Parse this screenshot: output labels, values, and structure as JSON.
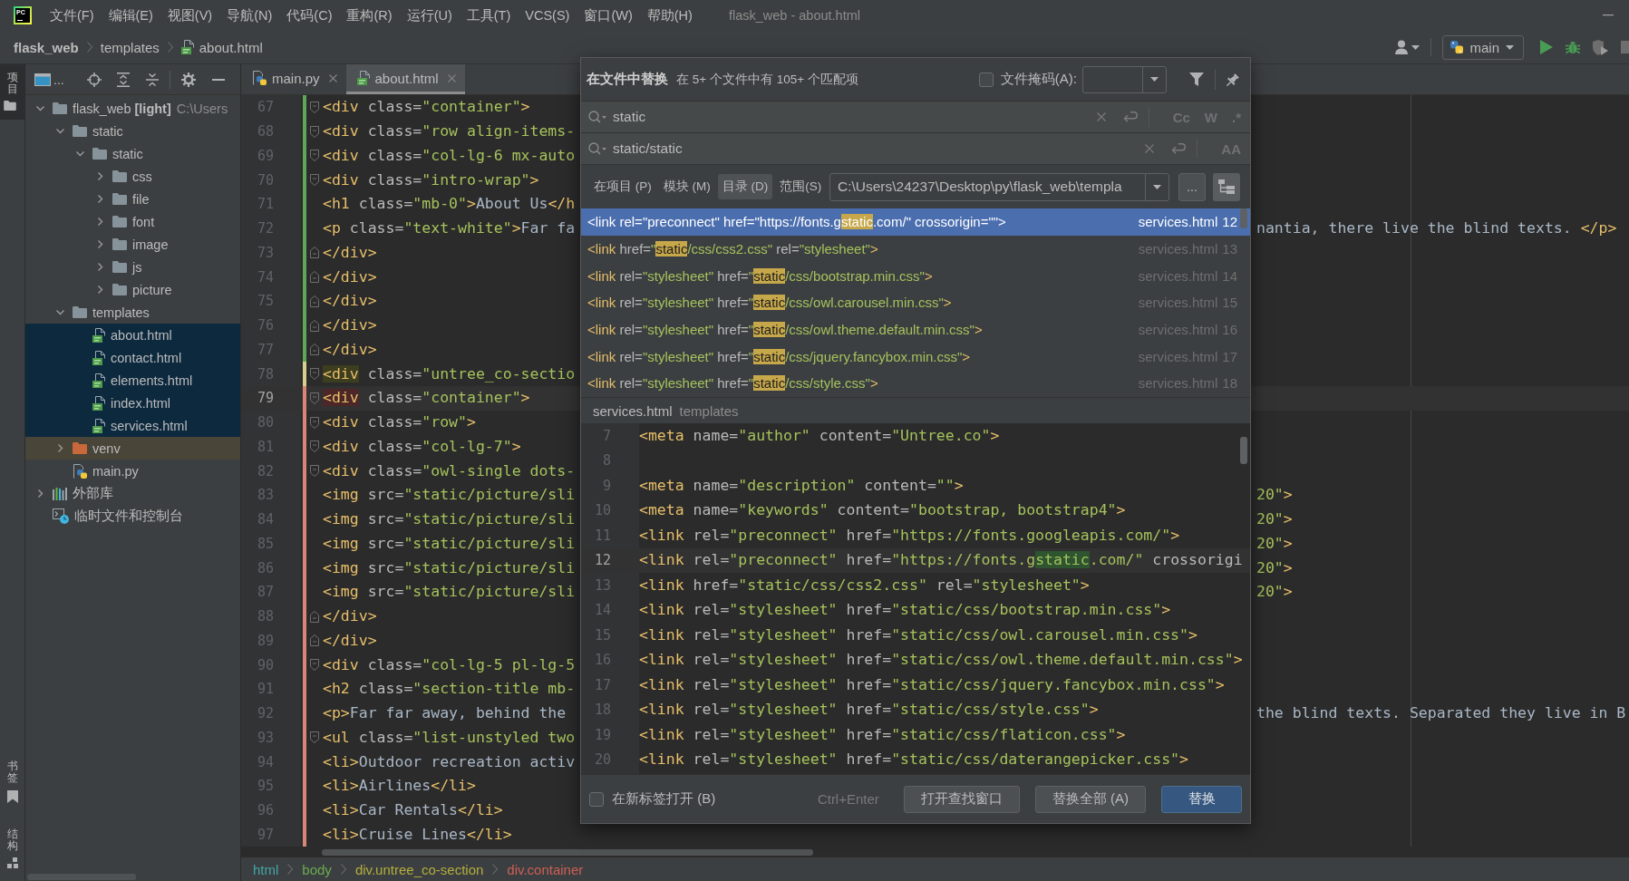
{
  "menu_bar": {
    "logo": "PC",
    "items": [
      "文件(F)",
      "编辑(E)",
      "视图(V)",
      "导航(N)",
      "代码(C)",
      "重构(R)",
      "运行(U)",
      "工具(T)",
      "VCS(S)",
      "窗口(W)",
      "帮助(H)"
    ],
    "title": "flask_web - about.html"
  },
  "navigation_bar": {
    "breadcrumbs": [
      {
        "label": "flask_web",
        "kind": "project"
      },
      {
        "label": "templates",
        "kind": "folder"
      },
      {
        "label": "about.html",
        "kind": "html"
      }
    ],
    "run_configuration": "main"
  },
  "tool_stripe": {
    "top": [
      {
        "label": "项目",
        "kind": "project",
        "selected": true
      }
    ],
    "bottom": [
      {
        "label": "书签",
        "kind": "bookmarks",
        "selected": false
      },
      {
        "label": "结构",
        "kind": "structure",
        "selected": false
      }
    ]
  },
  "project_panel": {
    "view_label": "...",
    "tree": [
      {
        "label": "flask_web **[light]**",
        "path": "C:\\Users",
        "kind": "folder",
        "expanded": true,
        "selected": false,
        "children": [
          {
            "label": "static",
            "kind": "folder",
            "expanded": true,
            "selected": false,
            "children": [
              {
                "label": "static",
                "kind": "folder",
                "expanded": true,
                "selected": false,
                "children": [
                  {
                    "label": "css",
                    "kind": "folder",
                    "expanded": false,
                    "selected": false
                  },
                  {
                    "label": "file",
                    "kind": "folder",
                    "expanded": false,
                    "selected": false
                  },
                  {
                    "label": "font",
                    "kind": "folder",
                    "expanded": false,
                    "selected": false
                  },
                  {
                    "label": "image",
                    "kind": "folder",
                    "expanded": false,
                    "selected": false
                  },
                  {
                    "label": "js",
                    "kind": "folder",
                    "expanded": false,
                    "selected": false
                  },
                  {
                    "label": "picture",
                    "kind": "folder",
                    "expanded": false,
                    "selected": false
                  }
                ]
              }
            ]
          },
          {
            "label": "templates",
            "kind": "folder",
            "expanded": true,
            "selected": false,
            "children": [
              {
                "label": "about.html",
                "kind": "html",
                "selected": true
              },
              {
                "label": "contact.html",
                "kind": "html",
                "selected": true
              },
              {
                "label": "elements.html",
                "kind": "html",
                "selected": true
              },
              {
                "label": "index.html",
                "kind": "html",
                "selected": true
              },
              {
                "label": "services.html",
                "kind": "html",
                "selected": true
              }
            ]
          },
          {
            "label": "venv",
            "kind": "excluded-folder",
            "expanded": false,
            "selected": false
          },
          {
            "label": "main.py",
            "kind": "python",
            "selected": false
          }
        ]
      },
      {
        "label": "外部库",
        "kind": "library",
        "expanded": false,
        "selected": false
      },
      {
        "label": "临时文件和控制台",
        "kind": "scratch",
        "selected": false
      }
    ]
  },
  "editor": {
    "tabs": [
      {
        "label": "main.py",
        "kind": "python",
        "selected": false
      },
      {
        "label": "about.html",
        "kind": "html",
        "selected": true
      }
    ],
    "lines": [
      {
        "number": "67",
        "text": "<div class=\"container\">",
        "color": "#5fa758",
        "kind": "fold-start",
        "current": false
      },
      {
        "number": "68",
        "text": "<div class=\"row align-items-",
        "color": "#5fa758",
        "kind": "fold-start",
        "current": false
      },
      {
        "number": "69",
        "text": "<div class=\"col-lg-6 mx-auto",
        "color": "#5fa758",
        "kind": "fold-start",
        "current": false
      },
      {
        "number": "70",
        "text": "<div class=\"intro-wrap\">",
        "color": "#5fa758",
        "kind": "fold-start",
        "current": false
      },
      {
        "number": "71",
        "text": "<h1 class=\"mb-0\">About Us</h",
        "color": "#5fa758",
        "kind": "plain",
        "current": false
      },
      {
        "number": "72",
        "text": "<p class=\"text-white\">Far fa",
        "tail": "nantia, there live the blind texts. </p>",
        "color": "#5fa758",
        "kind": "plain",
        "current": false
      },
      {
        "number": "73",
        "text": "</div>",
        "color": "#5fa758",
        "kind": "fold-end",
        "current": false
      },
      {
        "number": "74",
        "text": "</div>",
        "color": "#5fa758",
        "kind": "fold-end",
        "current": false
      },
      {
        "number": "75",
        "text": "</div>",
        "color": "#5fa758",
        "kind": "fold-end",
        "current": false
      },
      {
        "number": "76",
        "text": "</div>",
        "color": "#5fa758",
        "kind": "fold-end",
        "current": false
      },
      {
        "number": "77",
        "text": "</div>",
        "color": "#5fa758",
        "kind": "fold-end",
        "current": false
      },
      {
        "number": "78",
        "text": "<div class=\"untree_co-sectio",
        "color": "#d8cf8e",
        "kind": "fold-start",
        "tag_highlight": {
          "kind": "matched"
        },
        "current": false
      },
      {
        "number": "79",
        "text": "<div class=\"container\">",
        "color": "#d88677",
        "kind": "fold-start",
        "tag_highlight": {
          "kind": "unmatched"
        },
        "current": true
      },
      {
        "number": "80",
        "text": "<div class=\"row\">",
        "color": "#d88677",
        "kind": "fold-start",
        "current": false
      },
      {
        "number": "81",
        "text": "<div class=\"col-lg-7\">",
        "color": "#d88677",
        "kind": "fold-start",
        "current": false
      },
      {
        "number": "82",
        "text": "<div class=\"owl-single dots-",
        "color": "#d88677",
        "kind": "fold-start",
        "current": false
      },
      {
        "number": "83",
        "text": "<img src=\"static/picture/sli",
        "tail": "20\">",
        "color": "#d88677",
        "kind": "plain",
        "current": false
      },
      {
        "number": "84",
        "text": "<img src=\"static/picture/sli",
        "tail": "20\">",
        "color": "#d88677",
        "kind": "plain",
        "current": false
      },
      {
        "number": "85",
        "text": "<img src=\"static/picture/sli",
        "tail": "20\">",
        "color": "#d88677",
        "kind": "plain",
        "current": false
      },
      {
        "number": "86",
        "text": "<img src=\"static/picture/sli",
        "tail": "20\">",
        "color": "#d88677",
        "kind": "plain",
        "current": false
      },
      {
        "number": "87",
        "text": "<img src=\"static/picture/sli",
        "tail": "20\">",
        "color": "#d88677",
        "kind": "plain",
        "current": false
      },
      {
        "number": "88",
        "text": "</div>",
        "color": "#d88677",
        "kind": "fold-end",
        "current": false
      },
      {
        "number": "89",
        "text": "</div>",
        "color": "#d88677",
        "kind": "fold-end",
        "current": false
      },
      {
        "number": "90",
        "text": "<div class=\"col-lg-5 pl-lg-5",
        "color": "#d88677",
        "kind": "fold-start",
        "current": false
      },
      {
        "number": "91",
        "text": "<h2 class=\"section-title mb-",
        "color": "#d88677",
        "kind": "plain",
        "current": false
      },
      {
        "number": "92",
        "text": "<p>Far far away, behind the",
        "tail": "the blind texts. Separated they live in B",
        "color": "#d88677",
        "kind": "plain",
        "current": false
      },
      {
        "number": "93",
        "text": "<ul class=\"list-unstyled two",
        "color": "#d88677",
        "kind": "fold-start",
        "current": false
      },
      {
        "number": "94",
        "text": "<li>Outdoor recreation activ",
        "color": "#d88677",
        "kind": "plain",
        "current": false
      },
      {
        "number": "95",
        "text": "<li>Airlines</li>",
        "color": "#d88677",
        "kind": "plain",
        "current": false
      },
      {
        "number": "96",
        "text": "<li>Car Rentals</li>",
        "color": "#d88677",
        "kind": "plain",
        "current": false
      },
      {
        "number": "97",
        "text": "<li>Cruise Lines</li>",
        "color": "#d88677",
        "kind": "plain",
        "current": false
      }
    ],
    "breadcrumbs": [
      {
        "label": "html",
        "color": "#41a6a6"
      },
      {
        "label": "body",
        "color": "#6aab4f"
      },
      {
        "label": "div.untree_co-section",
        "color": "#b3ae3c"
      },
      {
        "label": "div.container",
        "color": "#cc5f55"
      }
    ]
  },
  "replace_dialog": {
    "title": "在文件中替换",
    "summary": "在 5+ 个文件中有 105+ 个匹配项",
    "file_mask": {
      "label": "文件掩码(A):",
      "checked": false
    },
    "search": {
      "value": "static",
      "options": [
        {
          "label": "Cc",
          "selected": false
        },
        {
          "label": "W",
          "selected": false
        },
        {
          "label": ".*",
          "selected": false
        }
      ]
    },
    "replace": {
      "value": "static/static",
      "options": [
        {
          "label": "AA",
          "selected": false
        }
      ]
    },
    "scopes": [
      {
        "label": "在项目 (P)",
        "selected": false
      },
      {
        "label": "模块 (M)",
        "selected": false
      },
      {
        "label": "目录 (D)",
        "selected": true
      },
      {
        "label": "范围(S)",
        "selected": false
      }
    ],
    "directory": "C:\\Users\\24237\\Desktop\\py\\flask_web\\templa",
    "more_button": "...",
    "results": [
      {
        "before": "<link rel=\"preconnect\" href=\"https://fonts.g",
        "match": "static",
        "after": ".com/\" crossorigin=\"\">",
        "file": "services.html",
        "line": "12",
        "selected": true
      },
      {
        "before": "<link href=\"",
        "match": "static",
        "after": "/css/css2.css\" rel=\"stylesheet\">",
        "file": "services.html",
        "line": "13",
        "selected": false
      },
      {
        "before": "<link rel=\"stylesheet\" href=\"",
        "match": "static",
        "after": "/css/bootstrap.min.css\">",
        "file": "services.html",
        "line": "14",
        "selected": false
      },
      {
        "before": "<link rel=\"stylesheet\" href=\"",
        "match": "static",
        "after": "/css/owl.carousel.min.css\">",
        "file": "services.html",
        "line": "15",
        "selected": false
      },
      {
        "before": "<link rel=\"stylesheet\" href=\"",
        "match": "static",
        "after": "/css/owl.theme.default.min.css\">",
        "file": "services.html",
        "line": "16",
        "selected": false
      },
      {
        "before": "<link rel=\"stylesheet\" href=\"",
        "match": "static",
        "after": "/css/jquery.fancybox.min.css\">",
        "file": "services.html",
        "line": "17",
        "selected": false
      },
      {
        "before": "<link rel=\"stylesheet\" href=\"",
        "match": "static",
        "after": "/css/style.css\">",
        "file": "services.html",
        "line": "18",
        "selected": false
      }
    ],
    "preview": {
      "file": "services.html",
      "folder": "templates",
      "lines": [
        {
          "number": "7",
          "text": "<meta name=\"author\" content=\"Untree.co\">",
          "current": false
        },
        {
          "number": "8",
          "current": false
        },
        {
          "number": "9",
          "text": "<meta name=\"description\" content=\"\">",
          "current": false
        },
        {
          "number": "10",
          "text": "<meta name=\"keywords\" content=\"bootstrap, bootstrap4\">",
          "current": false
        },
        {
          "number": "11",
          "text": "<link rel=\"preconnect\" href=\"https://fonts.googleapis.com/\">",
          "current": false
        },
        {
          "number": "12",
          "segments": [
            {
              "text": "<link rel=\"preconnect\" href=\"https://fonts.g",
              "match": false
            },
            {
              "text": "static",
              "match": true
            },
            {
              "text": ".com/\" crossorigi",
              "match": false
            }
          ],
          "current": true
        },
        {
          "number": "13",
          "text": "<link href=\"static/css/css2.css\" rel=\"stylesheet\">",
          "current": false
        },
        {
          "number": "14",
          "text": "<link rel=\"stylesheet\" href=\"static/css/bootstrap.min.css\">",
          "current": false
        },
        {
          "number": "15",
          "text": "<link rel=\"stylesheet\" href=\"static/css/owl.carousel.min.css\">",
          "current": false
        },
        {
          "number": "16",
          "text": "<link rel=\"stylesheet\" href=\"static/css/owl.theme.default.min.css\">",
          "current": false
        },
        {
          "number": "17",
          "text": "<link rel=\"stylesheet\" href=\"static/css/jquery.fancybox.min.css\">",
          "current": false
        },
        {
          "number": "18",
          "text": "<link rel=\"stylesheet\" href=\"static/css/style.css\">",
          "current": false
        },
        {
          "number": "19",
          "text": "<link rel=\"stylesheet\" href=\"static/css/flaticon.css\">",
          "current": false
        },
        {
          "number": "20",
          "text": "<link rel=\"stylesheet\" href=\"static/css/daterangepicker.css\">",
          "current": false
        }
      ]
    },
    "open_in_new_tab": {
      "label": "在新标签打开 (B)",
      "checked": false
    },
    "shortcut": "Ctrl+Enter",
    "buttons": [
      {
        "label": "打开查找窗口",
        "kind": "default"
      },
      {
        "label": "替换全部 (A)",
        "kind": "default"
      },
      {
        "label": "替换",
        "kind": "primary"
      }
    ]
  }
}
